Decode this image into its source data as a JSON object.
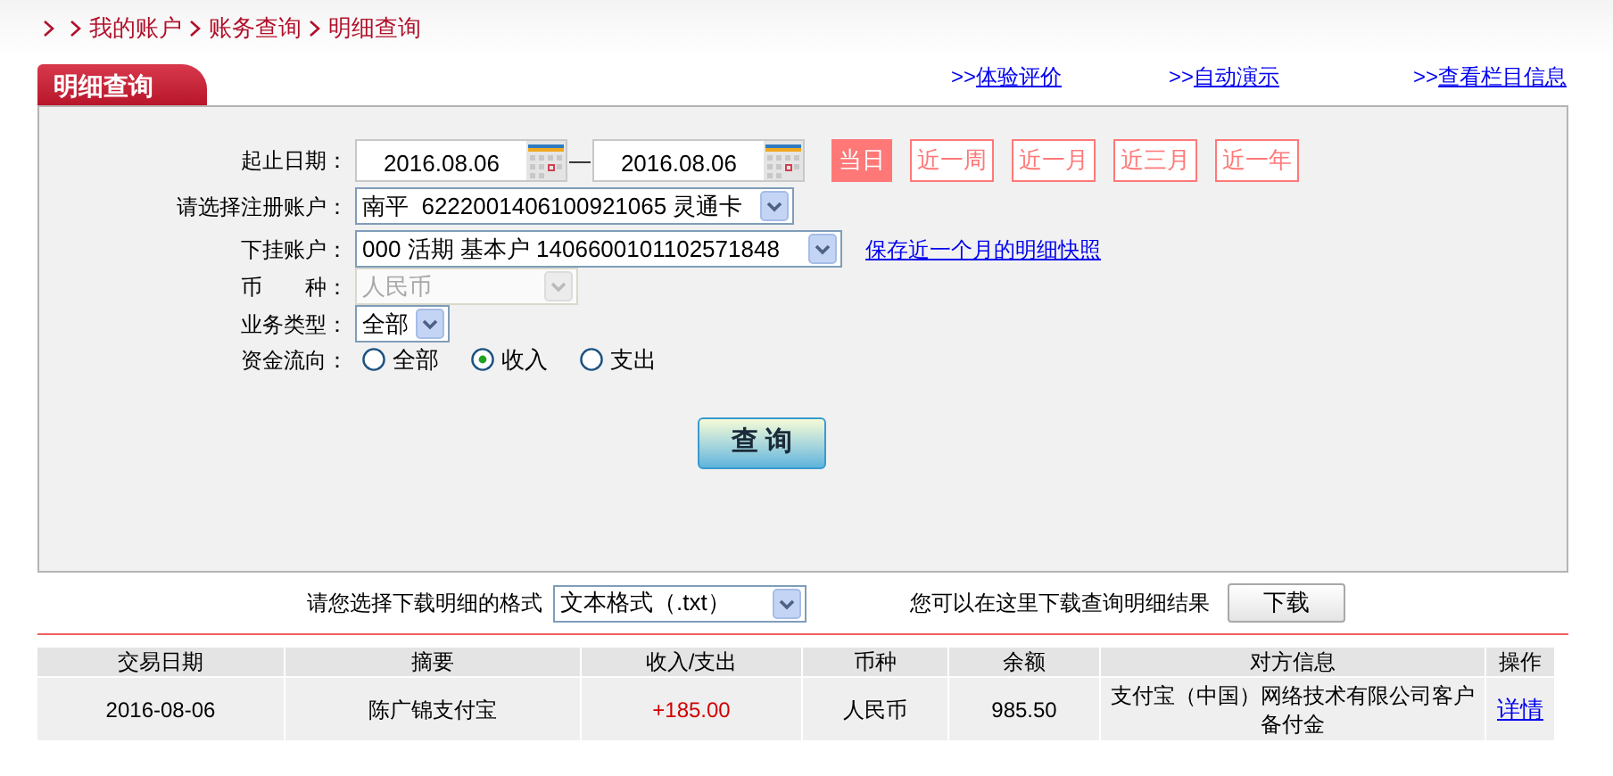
{
  "breadcrumb": [
    "我的账户",
    "账务查询",
    "明细查询"
  ],
  "panel_tab": "明细查询",
  "top_links": [
    {
      "prefix": ">>",
      "label": "体验评价"
    },
    {
      "prefix": ">>",
      "label": "自动演示"
    },
    {
      "prefix": ">>",
      "label": "查看栏目信息"
    }
  ],
  "form": {
    "date_label": "起止日期：",
    "start_date": "2016.08.06",
    "date_separator": "—",
    "end_date": "2016.08.06",
    "ranges": [
      {
        "label": "当日",
        "selected": true
      },
      {
        "label": "近一周",
        "selected": false
      },
      {
        "label": "近一月",
        "selected": false
      },
      {
        "label": "近三月",
        "selected": false
      },
      {
        "label": "近一年",
        "selected": false
      }
    ],
    "selects": [
      {
        "label": "请选择注册账户：",
        "value": "南平  6222001406100921065 灵通卡",
        "disabled": false
      },
      {
        "label": "下挂账户：",
        "value": "000 活期 基本户 1406600101102571848",
        "disabled": false,
        "link": "保存近一个月的明细快照"
      },
      {
        "label": "币　　种：",
        "value": "人民币",
        "disabled": true
      },
      {
        "label": "业务类型：",
        "value": "全部",
        "disabled": false
      }
    ],
    "flow_label": "资金流向：",
    "flow_options": [
      {
        "label": "全部",
        "selected": false
      },
      {
        "label": "收入",
        "selected": true
      },
      {
        "label": "支出",
        "selected": false
      }
    ],
    "query_button": "查 询"
  },
  "download": {
    "label": "请您选择下载明细的格式",
    "format": "文本格式（.txt）",
    "hint": "您可以在这里下载查询明细结果",
    "button": "下载"
  },
  "table": {
    "columns": [
      "交易日期",
      "摘要",
      "收入/支出",
      "币种",
      "余额",
      "对方信息",
      "操作"
    ],
    "rows": [
      {
        "date": "2016-08-06",
        "summary": "陈广锦支付宝",
        "amount": "+185.00",
        "currency": "人民币",
        "balance": "985.50",
        "counterparty": "支付宝（中国）网络技术有限公司客户备付金",
        "action": "详情"
      }
    ]
  }
}
